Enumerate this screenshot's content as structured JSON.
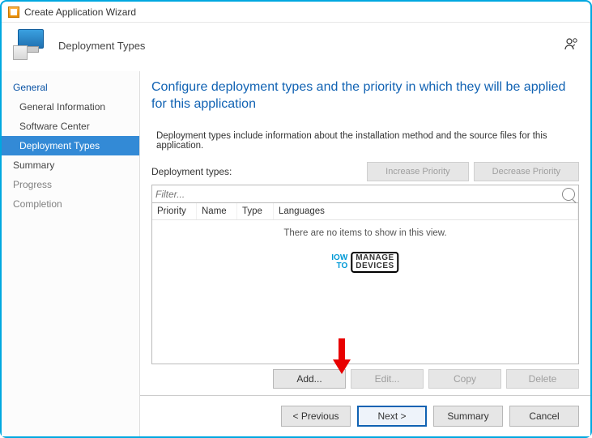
{
  "window": {
    "title": "Create Application Wizard"
  },
  "header": {
    "section": "Deployment Types"
  },
  "sidebar": {
    "items": [
      {
        "label": "General",
        "kind": "group"
      },
      {
        "label": "General Information",
        "kind": "item"
      },
      {
        "label": "Software Center",
        "kind": "item"
      },
      {
        "label": "Deployment Types",
        "kind": "active"
      },
      {
        "label": "Summary",
        "kind": "group"
      },
      {
        "label": "Progress",
        "kind": "dim"
      },
      {
        "label": "Completion",
        "kind": "dim"
      }
    ]
  },
  "main": {
    "heading": "Configure deployment types and the priority in which they will be applied for this application",
    "description": "Deployment types include information about the installation method and the source files for this application.",
    "list_label": "Deployment types:",
    "increase_btn": "Increase Priority",
    "decrease_btn": "Decrease Priority",
    "filter_placeholder": "Filter...",
    "columns": {
      "c0": "Priority",
      "c1": "Name",
      "c2": "Type",
      "c3": "Languages"
    },
    "empty_text": "There are no items to show in this view.",
    "actions": {
      "add": "Add...",
      "edit": "Edit...",
      "copy": "Copy",
      "delete": "Delete"
    }
  },
  "footer": {
    "prev": "< Previous",
    "next": "Next >",
    "summary": "Summary",
    "cancel": "Cancel"
  },
  "watermark": {
    "a": "IOW",
    "b": "TO",
    "c": "MANAGE",
    "d": "DEVICES"
  }
}
